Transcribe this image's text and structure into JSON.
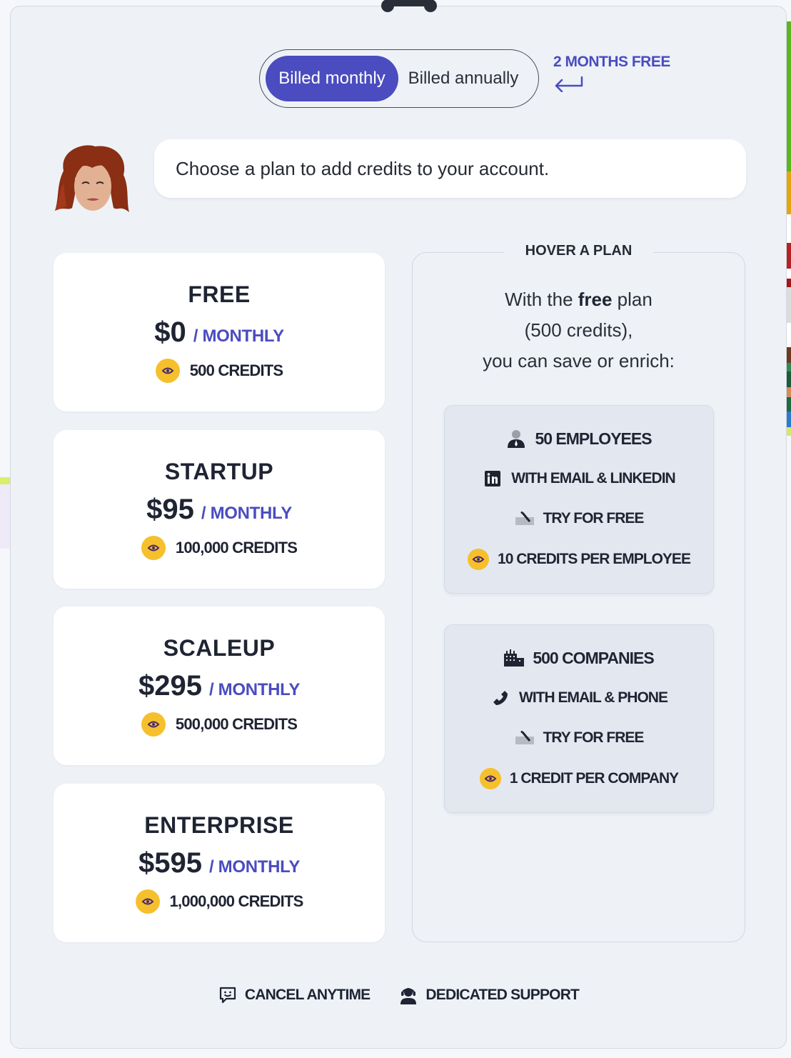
{
  "billing_toggle": {
    "options": [
      {
        "label": "Billed monthly",
        "active": true
      },
      {
        "label": "Billed annually",
        "active": false
      }
    ],
    "promo_label": "2 MONTHS FREE"
  },
  "assistant": {
    "message": "Choose a plan to add credits to your account."
  },
  "plans": [
    {
      "name": "FREE",
      "price": "$0",
      "period": "/ MONTHLY",
      "credits": "500 CREDITS"
    },
    {
      "name": "STARTUP",
      "price": "$95",
      "period": "/ MONTHLY",
      "credits": "100,000 CREDITS"
    },
    {
      "name": "SCALEUP",
      "price": "$295",
      "period": "/ MONTHLY",
      "credits": "500,000 CREDITS"
    },
    {
      "name": "ENTERPRISE",
      "price": "$595",
      "period": "/ MONTHLY",
      "credits": "1,000,000 CREDITS"
    }
  ],
  "details_panel": {
    "title": "HOVER A PLAN",
    "desc_prefix": "With the ",
    "desc_plan": "free",
    "desc_suffix": " plan",
    "desc_line2": "(500 credits),",
    "desc_line3": "you can save or enrich:",
    "boxes": [
      {
        "rows": [
          {
            "icon": "person-icon",
            "text": "50 EMPLOYEES"
          },
          {
            "icon": "linkedin-icon",
            "text": "WITH EMAIL & LINKEDIN"
          },
          {
            "icon": "check-pen-icon",
            "text": "TRY FOR FREE"
          },
          {
            "icon": "coin-icon",
            "text": "10 CREDITS PER EMPLOYEE"
          }
        ]
      },
      {
        "rows": [
          {
            "icon": "buildings-icon",
            "text": "500 COMPANIES"
          },
          {
            "icon": "phone-icon",
            "text": "WITH EMAIL & PHONE"
          },
          {
            "icon": "check-pen-icon",
            "text": "TRY FOR FREE"
          },
          {
            "icon": "coin-icon",
            "text": "1 CREDIT PER COMPANY"
          }
        ]
      }
    ]
  },
  "footer": {
    "items": [
      {
        "icon": "chat-smile-icon",
        "text": "CANCEL ANYTIME"
      },
      {
        "icon": "headset-support-icon",
        "text": "DEDICATED SUPPORT"
      }
    ]
  },
  "colors": {
    "accent": "#4a4cbf",
    "coin": "#f6c02c",
    "background": "#eef2f7"
  }
}
